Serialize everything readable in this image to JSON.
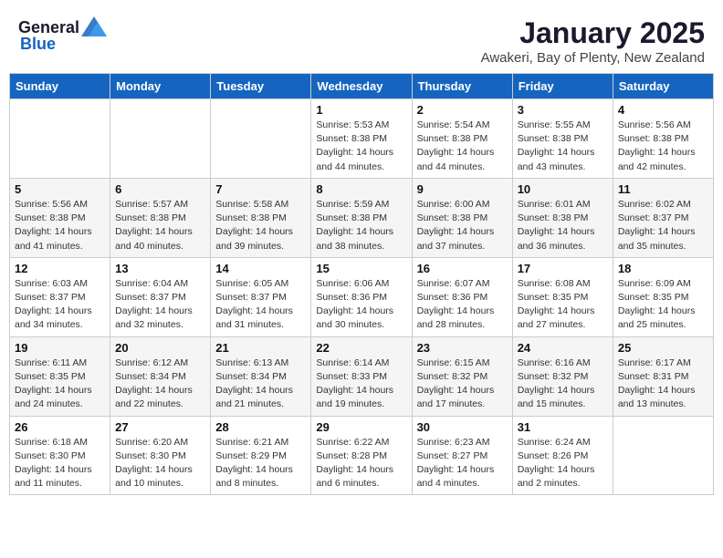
{
  "header": {
    "logo_general": "General",
    "logo_blue": "Blue",
    "title": "January 2025",
    "subtitle": "Awakeri, Bay of Plenty, New Zealand"
  },
  "weekdays": [
    "Sunday",
    "Monday",
    "Tuesday",
    "Wednesday",
    "Thursday",
    "Friday",
    "Saturday"
  ],
  "weeks": [
    [
      null,
      null,
      null,
      {
        "day": "1",
        "sunrise": "5:53 AM",
        "sunset": "8:38 PM",
        "daylight": "14 hours and 44 minutes."
      },
      {
        "day": "2",
        "sunrise": "5:54 AM",
        "sunset": "8:38 PM",
        "daylight": "14 hours and 44 minutes."
      },
      {
        "day": "3",
        "sunrise": "5:55 AM",
        "sunset": "8:38 PM",
        "daylight": "14 hours and 43 minutes."
      },
      {
        "day": "4",
        "sunrise": "5:56 AM",
        "sunset": "8:38 PM",
        "daylight": "14 hours and 42 minutes."
      }
    ],
    [
      {
        "day": "5",
        "sunrise": "5:56 AM",
        "sunset": "8:38 PM",
        "daylight": "14 hours and 41 minutes."
      },
      {
        "day": "6",
        "sunrise": "5:57 AM",
        "sunset": "8:38 PM",
        "daylight": "14 hours and 40 minutes."
      },
      {
        "day": "7",
        "sunrise": "5:58 AM",
        "sunset": "8:38 PM",
        "daylight": "14 hours and 39 minutes."
      },
      {
        "day": "8",
        "sunrise": "5:59 AM",
        "sunset": "8:38 PM",
        "daylight": "14 hours and 38 minutes."
      },
      {
        "day": "9",
        "sunrise": "6:00 AM",
        "sunset": "8:38 PM",
        "daylight": "14 hours and 37 minutes."
      },
      {
        "day": "10",
        "sunrise": "6:01 AM",
        "sunset": "8:38 PM",
        "daylight": "14 hours and 36 minutes."
      },
      {
        "day": "11",
        "sunrise": "6:02 AM",
        "sunset": "8:37 PM",
        "daylight": "14 hours and 35 minutes."
      }
    ],
    [
      {
        "day": "12",
        "sunrise": "6:03 AM",
        "sunset": "8:37 PM",
        "daylight": "14 hours and 34 minutes."
      },
      {
        "day": "13",
        "sunrise": "6:04 AM",
        "sunset": "8:37 PM",
        "daylight": "14 hours and 32 minutes."
      },
      {
        "day": "14",
        "sunrise": "6:05 AM",
        "sunset": "8:37 PM",
        "daylight": "14 hours and 31 minutes."
      },
      {
        "day": "15",
        "sunrise": "6:06 AM",
        "sunset": "8:36 PM",
        "daylight": "14 hours and 30 minutes."
      },
      {
        "day": "16",
        "sunrise": "6:07 AM",
        "sunset": "8:36 PM",
        "daylight": "14 hours and 28 minutes."
      },
      {
        "day": "17",
        "sunrise": "6:08 AM",
        "sunset": "8:35 PM",
        "daylight": "14 hours and 27 minutes."
      },
      {
        "day": "18",
        "sunrise": "6:09 AM",
        "sunset": "8:35 PM",
        "daylight": "14 hours and 25 minutes."
      }
    ],
    [
      {
        "day": "19",
        "sunrise": "6:11 AM",
        "sunset": "8:35 PM",
        "daylight": "14 hours and 24 minutes."
      },
      {
        "day": "20",
        "sunrise": "6:12 AM",
        "sunset": "8:34 PM",
        "daylight": "14 hours and 22 minutes."
      },
      {
        "day": "21",
        "sunrise": "6:13 AM",
        "sunset": "8:34 PM",
        "daylight": "14 hours and 21 minutes."
      },
      {
        "day": "22",
        "sunrise": "6:14 AM",
        "sunset": "8:33 PM",
        "daylight": "14 hours and 19 minutes."
      },
      {
        "day": "23",
        "sunrise": "6:15 AM",
        "sunset": "8:32 PM",
        "daylight": "14 hours and 17 minutes."
      },
      {
        "day": "24",
        "sunrise": "6:16 AM",
        "sunset": "8:32 PM",
        "daylight": "14 hours and 15 minutes."
      },
      {
        "day": "25",
        "sunrise": "6:17 AM",
        "sunset": "8:31 PM",
        "daylight": "14 hours and 13 minutes."
      }
    ],
    [
      {
        "day": "26",
        "sunrise": "6:18 AM",
        "sunset": "8:30 PM",
        "daylight": "14 hours and 11 minutes."
      },
      {
        "day": "27",
        "sunrise": "6:20 AM",
        "sunset": "8:30 PM",
        "daylight": "14 hours and 10 minutes."
      },
      {
        "day": "28",
        "sunrise": "6:21 AM",
        "sunset": "8:29 PM",
        "daylight": "14 hours and 8 minutes."
      },
      {
        "day": "29",
        "sunrise": "6:22 AM",
        "sunset": "8:28 PM",
        "daylight": "14 hours and 6 minutes."
      },
      {
        "day": "30",
        "sunrise": "6:23 AM",
        "sunset": "8:27 PM",
        "daylight": "14 hours and 4 minutes."
      },
      {
        "day": "31",
        "sunrise": "6:24 AM",
        "sunset": "8:26 PM",
        "daylight": "14 hours and 2 minutes."
      },
      null
    ]
  ],
  "labels": {
    "sunrise_prefix": "Sunrise: ",
    "sunset_prefix": "Sunset: ",
    "daylight_prefix": "Daylight: "
  }
}
